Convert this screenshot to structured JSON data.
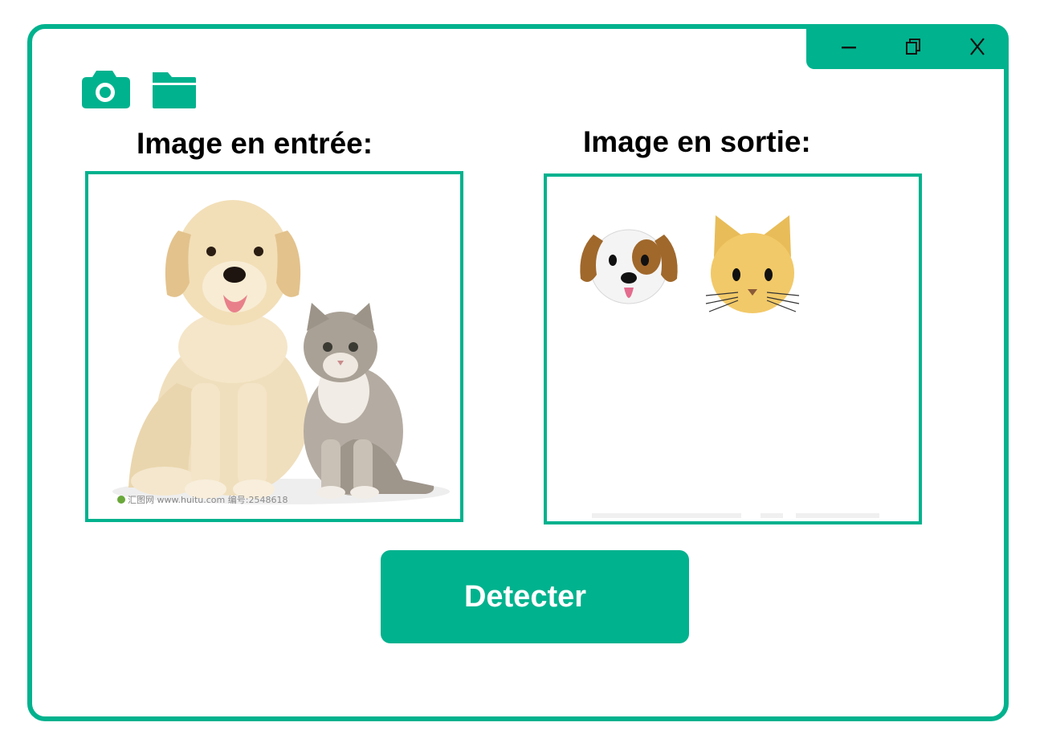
{
  "window": {
    "accent_color": "#00b28e",
    "controls": {
      "minimize_icon": "minimize-icon",
      "maximize_icon": "restore-icon",
      "close_icon": "close-icon"
    }
  },
  "toolbar": {
    "camera_icon": "camera-icon",
    "folder_icon": "folder-icon"
  },
  "input_panel": {
    "label": "Image en entrée:",
    "image": "photo-dog-and-kitten",
    "watermark": "汇图网 www.huitu.com 编号:2548618"
  },
  "output_panel": {
    "label": "Image en sortie:",
    "detections": [
      "dog-face-emoji",
      "cat-face-emoji"
    ]
  },
  "detect_button": {
    "label": "Detecter"
  }
}
